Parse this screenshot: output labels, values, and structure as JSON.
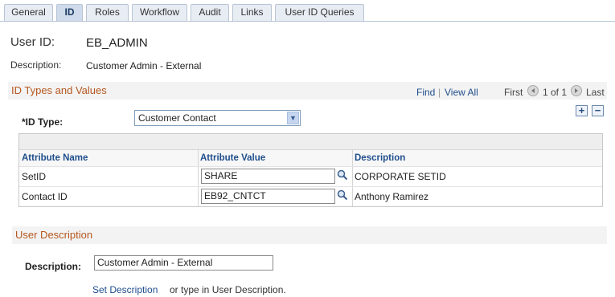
{
  "tabs": [
    {
      "label": "General",
      "active": false
    },
    {
      "label": "ID",
      "active": true
    },
    {
      "label": "Roles",
      "active": false
    },
    {
      "label": "Workflow",
      "active": false
    },
    {
      "label": "Audit",
      "active": false
    },
    {
      "label": "Links",
      "active": false
    },
    {
      "label": "User ID Queries",
      "active": false
    }
  ],
  "user": {
    "id_label": "User ID:",
    "id_value": "EB_ADMIN",
    "desc_label": "Description:",
    "desc_value": "Customer Admin - External"
  },
  "id_types": {
    "section_title": "ID Types and Values",
    "find": "Find",
    "separator": "|",
    "view_all": "View All",
    "first": "First",
    "pager": "1 of 1",
    "last": "Last",
    "add": "+",
    "remove": "−",
    "id_type_label": "*ID Type:",
    "id_type_value": "Customer Contact"
  },
  "attributes": {
    "headers": [
      "Attribute Name",
      "Attribute Value",
      "Description"
    ],
    "rows": [
      {
        "name": "SetID",
        "value": "SHARE",
        "description": "CORPORATE SETID"
      },
      {
        "name": "Contact ID",
        "value": "EB92_CNTCT",
        "description": "Anthony Ramirez"
      }
    ]
  },
  "user_description": {
    "section_title": "User Description",
    "label": "Description:",
    "value": "Customer Admin - External",
    "set_link": "Set Description",
    "hint": "or type in User Description."
  },
  "colors": {
    "section_title": "#b5571e",
    "link": "#1f4e8c",
    "active_tab": "#cfdbea"
  },
  "icons": [
    "lookup-icon",
    "arrow-left-icon",
    "arrow-right-icon",
    "chevron-down-icon",
    "plus-icon",
    "minus-icon"
  ]
}
